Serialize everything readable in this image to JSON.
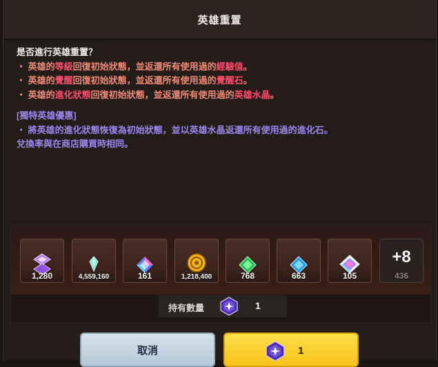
{
  "dialog": {
    "title": "英雄重置",
    "question": "是否進行英雄重置？",
    "lines": [
      {
        "pre": "・ 英雄的",
        "hl": "等級",
        "mid": "回復初始狀態，並返還所有使用過的",
        "hl2": "經驗值",
        "post": "。"
      },
      {
        "pre": "・ 英雄的",
        "hl": "覺醒",
        "mid": "回復初始狀態，並返還所有使用過的",
        "hl2": "覺醒石",
        "post": "。"
      },
      {
        "pre": "・ 英雄的",
        "hl": "進化狀態",
        "mid": "回復初始狀態，並返還所有使用過的",
        "hl2": "英雄水晶",
        "post": "。"
      }
    ],
    "exclusive_title": "[獨特英雄優惠]",
    "exclusive_lines": [
      "・ 將英雄的進化狀態恢復為初始狀態，並以英雄水晶返還所有使用過的進化石。",
      "兌換率與在商店購買時相同。"
    ]
  },
  "rewards": [
    {
      "icon": "purple-crystal-stack-icon",
      "count": "1,280"
    },
    {
      "icon": "teal-crystal-icon",
      "count": "4,559,160"
    },
    {
      "icon": "rainbow-gem-icon",
      "count": "161"
    },
    {
      "icon": "gold-coin-icon",
      "count": "1,218,400"
    },
    {
      "icon": "green-gem-icon",
      "count": "768"
    },
    {
      "icon": "blue-gem-icon",
      "count": "663"
    },
    {
      "icon": "prism-crystal-icon",
      "count": "105"
    }
  ],
  "more": {
    "label": "+8",
    "count": "436"
  },
  "owned": {
    "label": "持有數量",
    "value": "1"
  },
  "buttons": {
    "cancel": "取消",
    "confirm_value": "1"
  },
  "colors": {
    "highlight": "#ff4d6d",
    "bullet": "#ef8a77",
    "exclusive": "#9c86ee",
    "confirm": "#f6c21a",
    "cancel": "#c4d4e0"
  }
}
